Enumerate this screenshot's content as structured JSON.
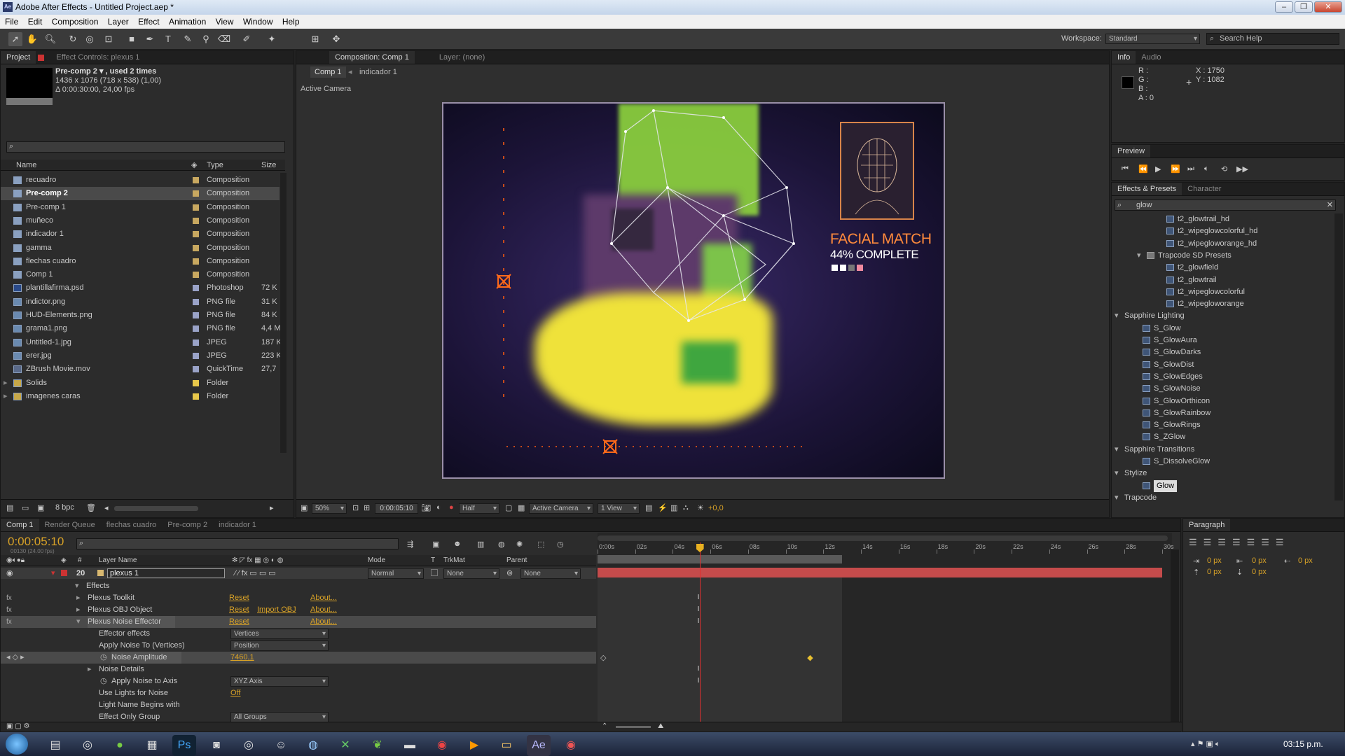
{
  "window": {
    "title": "Adobe After Effects - Untitled Project.aep *",
    "app_icon": "Ae",
    "controls": [
      "–",
      "❐",
      "✕"
    ]
  },
  "menu": [
    "File",
    "Edit",
    "Composition",
    "Layer",
    "Effect",
    "Animation",
    "View",
    "Window",
    "Help"
  ],
  "workspace": {
    "label": "Workspace:",
    "value": "Standard",
    "search_placeholder": "Search Help"
  },
  "project": {
    "tabs": [
      "Project",
      "Effect Controls: plexus 1"
    ],
    "selected_name": "Pre-comp 2 ▾ , used 2 times",
    "selected_size": "1436 x 1076  (718 x 538) (1,00)",
    "selected_duration": "Δ 0:00:30:00, 24,00 fps",
    "columns": [
      "Name",
      "Type",
      "Size"
    ],
    "items": [
      {
        "name": "recuadro",
        "type": "Composition",
        "size": "",
        "color": "#c8a860",
        "kind": "comp"
      },
      {
        "name": "Pre-comp 2",
        "type": "Composition",
        "size": "",
        "color": "#c8a860",
        "kind": "comp",
        "selected": true
      },
      {
        "name": "Pre-comp 1",
        "type": "Composition",
        "size": "",
        "color": "#c8a860",
        "kind": "comp"
      },
      {
        "name": "muñeco",
        "type": "Composition",
        "size": "",
        "color": "#c8a860",
        "kind": "comp"
      },
      {
        "name": "indicador 1",
        "type": "Composition",
        "size": "",
        "color": "#c8a860",
        "kind": "comp"
      },
      {
        "name": "gamma",
        "type": "Composition",
        "size": "",
        "color": "#c8a860",
        "kind": "comp"
      },
      {
        "name": "flechas cuadro",
        "type": "Composition",
        "size": "",
        "color": "#c8a860",
        "kind": "comp"
      },
      {
        "name": "Comp 1",
        "type": "Composition",
        "size": "",
        "color": "#c8a860",
        "kind": "comp"
      },
      {
        "name": "plantillafirma.psd",
        "type": "Photoshop",
        "size": "72 K",
        "color": "#9aa3c8",
        "kind": "psd"
      },
      {
        "name": "indictor.png",
        "type": "PNG file",
        "size": "31 K",
        "color": "#9aa3c8",
        "kind": "img"
      },
      {
        "name": "HUD-Elements.png",
        "type": "PNG file",
        "size": "84 K",
        "color": "#9aa3c8",
        "kind": "img"
      },
      {
        "name": "grama1.png",
        "type": "PNG file",
        "size": "4,4 M",
        "color": "#9aa3c8",
        "kind": "img"
      },
      {
        "name": "Untitled-1.jpg",
        "type": "JPEG",
        "size": "187 K",
        "color": "#9aa3c8",
        "kind": "img"
      },
      {
        "name": "erer.jpg",
        "type": "JPEG",
        "size": "223 K",
        "color": "#9aa3c8",
        "kind": "img"
      },
      {
        "name": "ZBrush Movie.mov",
        "type": "QuickTime",
        "size": "27,7",
        "color": "#9aa3c8",
        "kind": "mov"
      },
      {
        "name": "Solids",
        "type": "Folder",
        "size": "",
        "color": "#e8c84a",
        "kind": "folder"
      },
      {
        "name": "imagenes caras",
        "type": "Folder",
        "size": "",
        "color": "#e8c84a",
        "kind": "folder"
      }
    ],
    "bpc": "8 bpc"
  },
  "composition": {
    "tabs": [
      "Composition: Comp 1",
      "Layer: (none)"
    ],
    "breadcrumbs": [
      "Comp 1",
      "indicador 1"
    ],
    "active_camera_label": "Active Camera",
    "hud_title": "FACIAL MATCH",
    "hud_percent": "44% COMPLETE",
    "hud_progress": 0.44,
    "zoom": "50%",
    "timecode": "0:00:05:10",
    "resolution": "Half",
    "camera": "Active Camera",
    "views": "1 View",
    "exposure": "+0,0"
  },
  "info": {
    "tabs": [
      "Info",
      "Audio"
    ],
    "r": "R :",
    "g": "G :",
    "b": "B :",
    "a": "A : 0",
    "x": "X : 1750",
    "y": "Y : 1082"
  },
  "preview": {
    "tab": "Preview"
  },
  "effects_presets": {
    "tabs": [
      "Effects & Presets",
      "Character"
    ],
    "search": "glow",
    "items": [
      {
        "label": "t2_glowtrail_hd",
        "level": 3,
        "kind": "preset"
      },
      {
        "label": "t2_wipeglowcolorful_hd",
        "level": 3,
        "kind": "preset"
      },
      {
        "label": "t2_wipegloworange_hd",
        "level": 3,
        "kind": "preset"
      },
      {
        "label": "Trapcode SD Presets",
        "level": 2,
        "kind": "folder"
      },
      {
        "label": "t2_glowfield",
        "level": 3,
        "kind": "preset"
      },
      {
        "label": "t2_glowtrail",
        "level": 3,
        "kind": "preset"
      },
      {
        "label": "t2_wipeglowcolorful",
        "level": 3,
        "kind": "preset"
      },
      {
        "label": "t2_wipegloworange",
        "level": 3,
        "kind": "preset"
      },
      {
        "label": "Sapphire Lighting",
        "level": 0,
        "kind": "group"
      },
      {
        "label": "S_Glow",
        "level": 1,
        "kind": "effect"
      },
      {
        "label": "S_GlowAura",
        "level": 1,
        "kind": "effect"
      },
      {
        "label": "S_GlowDarks",
        "level": 1,
        "kind": "effect"
      },
      {
        "label": "S_GlowDist",
        "level": 1,
        "kind": "effect"
      },
      {
        "label": "S_GlowEdges",
        "level": 1,
        "kind": "effect"
      },
      {
        "label": "S_GlowNoise",
        "level": 1,
        "kind": "effect"
      },
      {
        "label": "S_GlowOrthicon",
        "level": 1,
        "kind": "effect"
      },
      {
        "label": "S_GlowRainbow",
        "level": 1,
        "kind": "effect"
      },
      {
        "label": "S_GlowRings",
        "level": 1,
        "kind": "effect"
      },
      {
        "label": "S_ZGlow",
        "level": 1,
        "kind": "effect"
      },
      {
        "label": "Sapphire Transitions",
        "level": 0,
        "kind": "group"
      },
      {
        "label": "S_DissolveGlow",
        "level": 1,
        "kind": "effect"
      },
      {
        "label": "Stylize",
        "level": 0,
        "kind": "group"
      },
      {
        "label": "Glow",
        "level": 1,
        "kind": "effect",
        "selected": true
      },
      {
        "label": "Trapcode",
        "level": 0,
        "kind": "group"
      }
    ]
  },
  "timeline": {
    "tabs": [
      "Comp 1",
      "Render Queue",
      "flechas cuadro",
      "Pre-comp 2",
      "indicador 1"
    ],
    "timecode": "0:00:05:10",
    "frame_info": "00130 (24.00 fps)",
    "columns": {
      "num": "#",
      "layer_name": "Layer Name",
      "mode": "Mode",
      "t": "T",
      "trkmat": "TrkMat",
      "parent": "Parent"
    },
    "layer": {
      "num": "20",
      "name": "plexus 1",
      "mode": "Normal",
      "trkmat": "None",
      "parent": "None"
    },
    "ruler": [
      "0:00s",
      "02s",
      "04s",
      "06s",
      "08s",
      "10s",
      "12s",
      "14s",
      "16s",
      "18s",
      "20s",
      "22s",
      "24s",
      "26s",
      "28s",
      "30s"
    ],
    "playhead_seconds": 5.42,
    "work_area_end_seconds": 13,
    "effects_rows": [
      {
        "label": "Effects",
        "indent": 0,
        "tw": "open"
      },
      {
        "label": "Plexus Toolkit",
        "indent": 1,
        "tw": "closed",
        "fx": true,
        "reset": "Reset",
        "about": "About..."
      },
      {
        "label": "Plexus OBJ Object",
        "indent": 1,
        "tw": "closed",
        "fx": true,
        "reset": "Reset",
        "import": "Import OBJ",
        "about": "About..."
      },
      {
        "label": "Plexus Noise Effector",
        "indent": 1,
        "tw": "open",
        "fx": true,
        "reset": "Reset",
        "about": "About...",
        "selected": true
      },
      {
        "label": "Effector effects",
        "indent": 2,
        "dropdown": "Vertices"
      },
      {
        "label": "Apply Noise To (Vertices)",
        "indent": 2,
        "dropdown": "Position"
      },
      {
        "label": "Noise Amplitude",
        "indent": 2,
        "value": "7460,1",
        "keyframes": true,
        "selected": true
      },
      {
        "label": "Noise Details",
        "indent": 2,
        "tw": "closed"
      },
      {
        "label": "Apply Noise to Axis",
        "indent": 2,
        "dropdown": "XYZ Axis",
        "stopwatch": true
      },
      {
        "label": "Use Lights for Noise",
        "indent": 2,
        "value": "Off"
      },
      {
        "label": "Light Name Begins with",
        "indent": 2
      },
      {
        "label": "Effect Only Group",
        "indent": 2,
        "dropdown": "All Groups"
      }
    ]
  },
  "paragraph": {
    "tab": "Paragraph",
    "fields": [
      "0 px",
      "0 px",
      "0 px",
      "0 px",
      "0 px"
    ]
  },
  "taskbar": {
    "clock": "03:15 p.m."
  },
  "colors": {
    "accent": "#d8a227",
    "layer_bar": "#c54b4b",
    "playhead": "#e03030",
    "label_red": "#cf3030"
  }
}
